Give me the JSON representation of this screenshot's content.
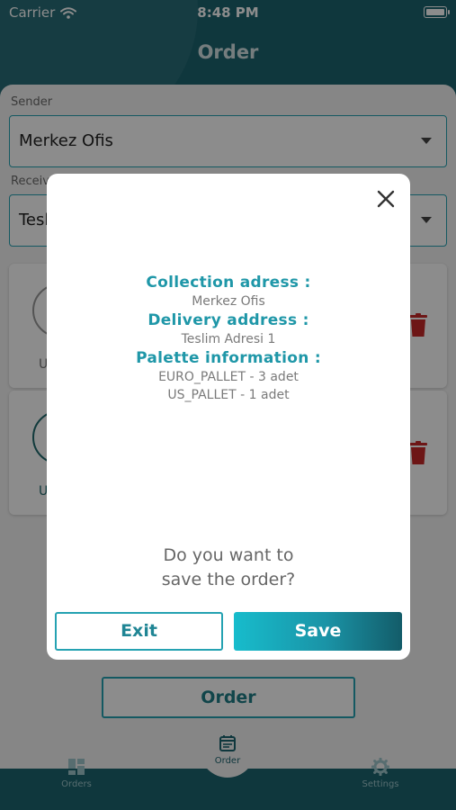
{
  "status_bar": {
    "carrier": "Carrier",
    "time": "8:48 PM"
  },
  "header": {
    "title": "Order"
  },
  "form": {
    "sender": {
      "label": "Sender",
      "value": "Merkez Ofis"
    },
    "receiver": {
      "label": "Receiver",
      "value": "Teslim Adresi 1"
    },
    "items": [
      {
        "label": "US"
      },
      {
        "label": "US"
      }
    ],
    "order_button_label": "Order"
  },
  "tabbar": {
    "left_label": "Orders",
    "center_label": "Order",
    "right_label": "Settings"
  },
  "modal": {
    "collection_heading": "Collection adress :",
    "collection_value": "Merkez Ofis",
    "delivery_heading": "Delivery address :",
    "delivery_value": "Teslim Adresi 1",
    "palette_heading": "Palette information :",
    "palette_items": [
      "EURO_PALLET - 3 adet",
      "US_PALLET - 1 adet"
    ],
    "question_line1": "Do you want to",
    "question_line2": "save the order?",
    "exit_label": "Exit",
    "save_label": "Save"
  },
  "colors": {
    "header_bg": "#1c6470",
    "accent": "#25a2b2",
    "heading_teal": "#1f97a8",
    "trash_red": "#c62828"
  },
  "icons": {
    "close": "close-icon",
    "trash": "trash-icon",
    "wifi": "wifi-icon",
    "battery": "battery-icon",
    "dashboard": "dashboard-icon",
    "calendar": "calendar-icon",
    "gear": "gear-icon"
  }
}
